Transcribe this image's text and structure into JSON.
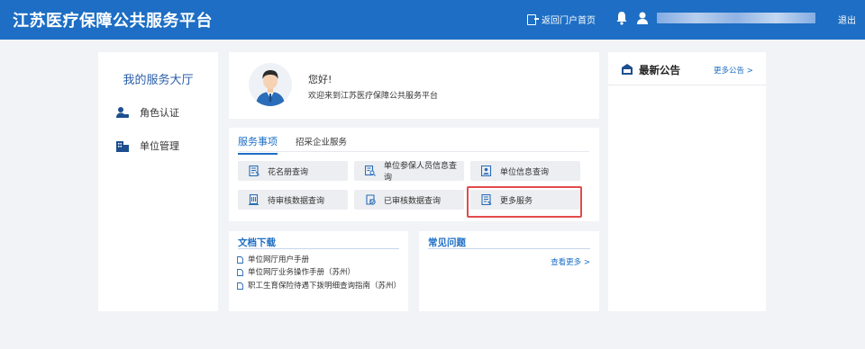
{
  "header": {
    "title": "江苏医疗保障公共服务平台",
    "portal_link": "返回门户首页",
    "logout": "退出"
  },
  "sidebar": {
    "title": "我的服务大厅",
    "items": [
      {
        "label": "角色认证",
        "icon": "user-key-icon"
      },
      {
        "label": "单位管理",
        "icon": "building-icon"
      }
    ]
  },
  "welcome": {
    "greeting": "您好!",
    "message": "欢迎来到江苏医疗保障公共服务平台"
  },
  "services": {
    "tabs": [
      {
        "label": "服务事项",
        "active": true
      },
      {
        "label": "招采企业服务",
        "active": false
      }
    ],
    "items": [
      {
        "label": "花名册查询",
        "icon": "form-icon"
      },
      {
        "label": "单位参保人员信息查询",
        "icon": "document-search-icon"
      },
      {
        "label": "单位信息查询",
        "icon": "id-card-icon"
      },
      {
        "label": "待审核数据查询",
        "icon": "building-doc-icon"
      },
      {
        "label": "已审核数据查询",
        "icon": "checked-icon"
      },
      {
        "label": "更多服务",
        "icon": "more-doc-icon",
        "highlighted": true
      }
    ],
    "highlight_color": "#e24b4b"
  },
  "docs": {
    "title": "文档下载",
    "items": [
      "单位网厅用户手册",
      "单位网厅业务操作手册（苏州）",
      "职工生育保险待遇下拨明细查询指南（苏州）"
    ]
  },
  "faq": {
    "title": "常见问题",
    "more": "查看更多 >"
  },
  "notice": {
    "title": "最新公告",
    "more": "更多公告 >"
  },
  "colors": {
    "brand": "#1d6ec4",
    "background": "#f1f3f6",
    "highlight": "#e24b4b"
  }
}
